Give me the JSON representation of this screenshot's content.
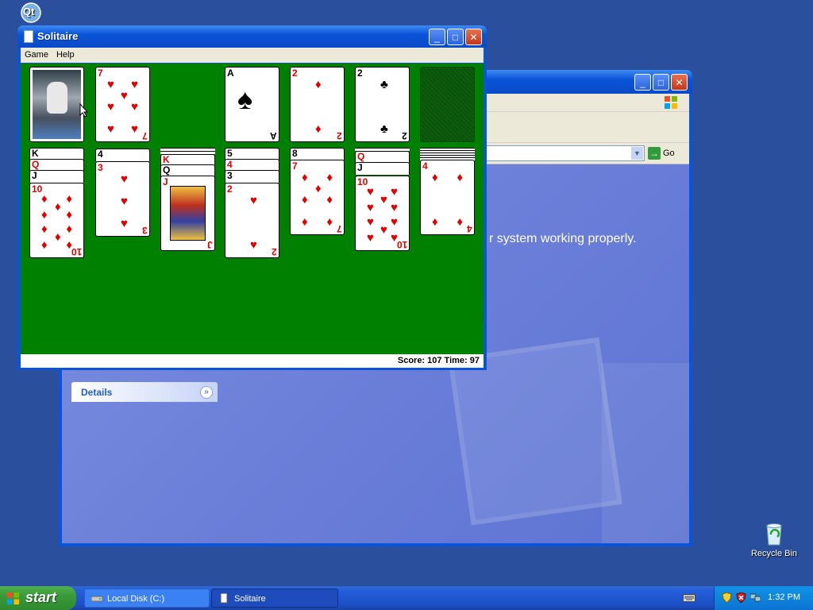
{
  "desktop": {
    "top_icon": {
      "label": "Qt"
    },
    "recycle_bin": {
      "label": "Recycle Bin"
    }
  },
  "explorer": {
    "go_label": "Go",
    "message": "r system working properly.",
    "details_label": "Details"
  },
  "solitaire": {
    "title": "Solitaire",
    "menu": {
      "game": "Game",
      "help": "Help"
    },
    "status": "Score: 107  Time: 97",
    "felt_color": "#008000"
  },
  "taskbar": {
    "start_label": "start",
    "tasks": [
      {
        "label": "Local Disk (C:)"
      },
      {
        "label": "Solitaire"
      }
    ],
    "clock": "1:32 PM"
  },
  "colors": {
    "titlebar": "#0a54d8",
    "desktop": "#2a4f9c",
    "taskbar": "#245edb",
    "start": "#3a9a38"
  }
}
